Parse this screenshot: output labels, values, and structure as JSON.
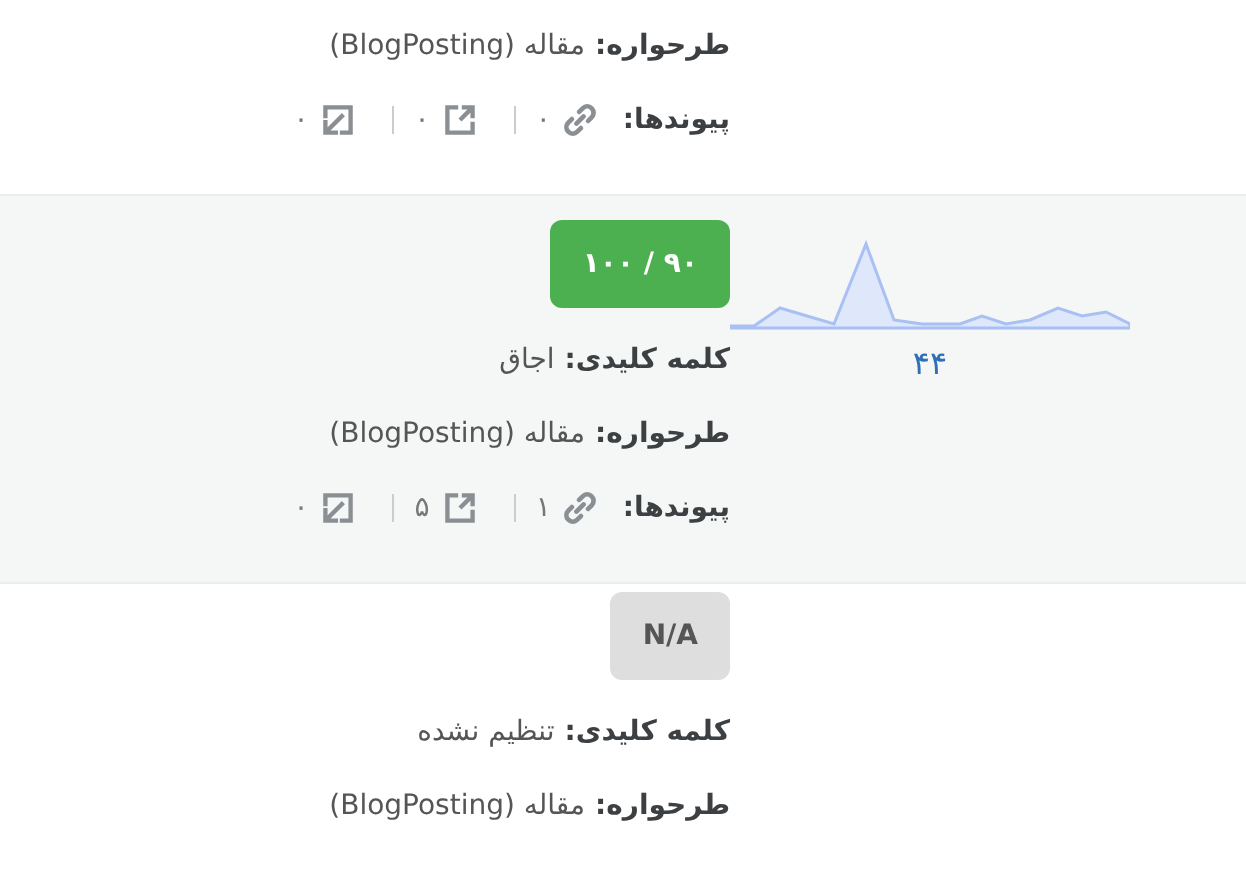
{
  "rows": [
    {
      "highlighted": false,
      "schema": {
        "label": "طرحواره:",
        "value": "مقاله (BlogPosting)"
      },
      "links": {
        "label": "پیوندها:",
        "internal": "۰",
        "external": "۰",
        "incoming": "۰"
      }
    },
    {
      "highlighted": true,
      "score": {
        "kind": "good",
        "text": "۹۰ / ۱۰۰"
      },
      "keyword": {
        "label": "کلمه کلیدی:",
        "value": "اجاق"
      },
      "schema": {
        "label": "طرحواره:",
        "value": "مقاله (BlogPosting)"
      },
      "links": {
        "label": "پیوندها:",
        "internal": "۱",
        "external": "۵",
        "incoming": "۰"
      },
      "traffic": {
        "value": "۴۴"
      }
    },
    {
      "highlighted": false,
      "score": {
        "kind": "none",
        "text": "N/A"
      },
      "keyword": {
        "label": "کلمه کلیدی:",
        "value": "تنظیم نشده"
      },
      "schema": {
        "label": "طرحواره:",
        "value": "مقاله (BlogPosting)"
      }
    }
  ]
}
